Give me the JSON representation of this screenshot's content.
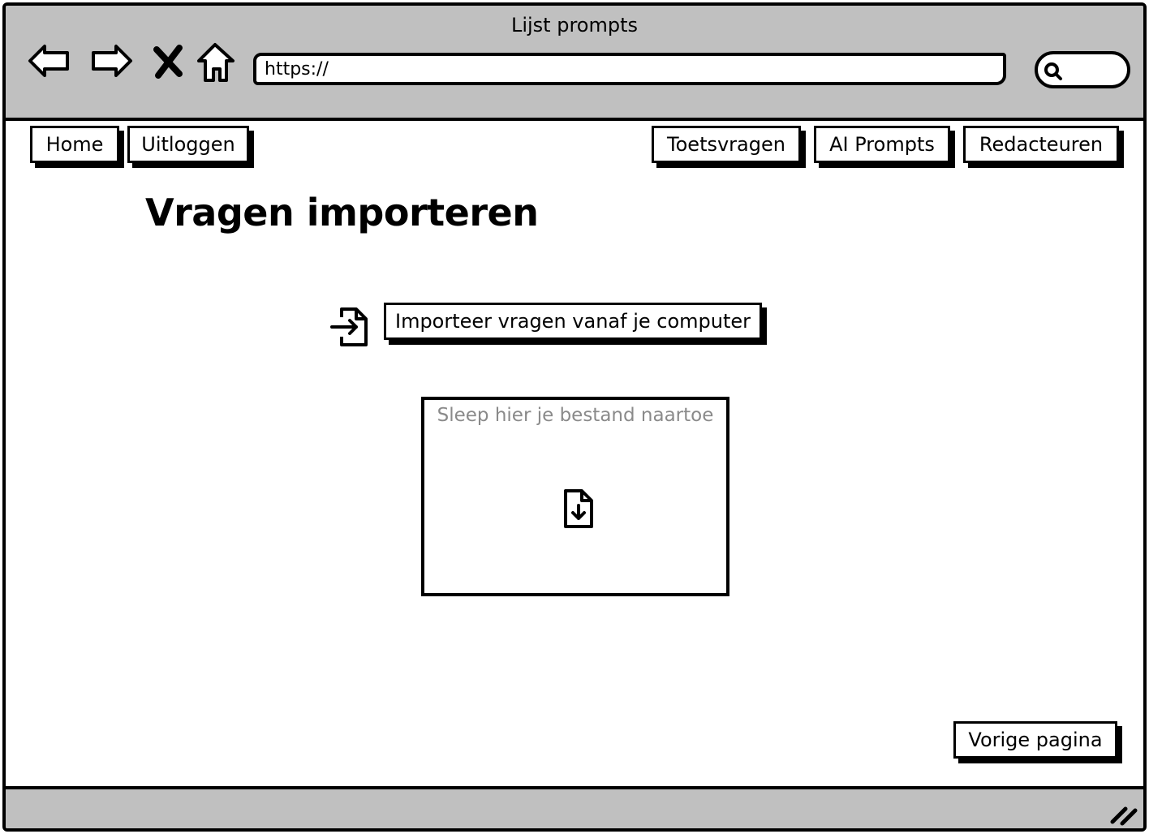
{
  "window": {
    "title": "Lijst prompts"
  },
  "browser": {
    "url": "https://",
    "icons": [
      "back-arrow-icon",
      "forward-arrow-icon",
      "stop-icon",
      "home-icon",
      "search-icon"
    ]
  },
  "nav": {
    "home": "Home",
    "logout": "Uitloggen",
    "test_questions": "Toetsvragen",
    "ai_prompts": "AI Prompts",
    "editors": "Redacteuren"
  },
  "main": {
    "title": "Vragen importeren",
    "import_button": "Importeer vragen vanaf je computer",
    "dropzone_label": "Sleep hier je bestand naartoe",
    "back_button": "Vorige pagina"
  }
}
